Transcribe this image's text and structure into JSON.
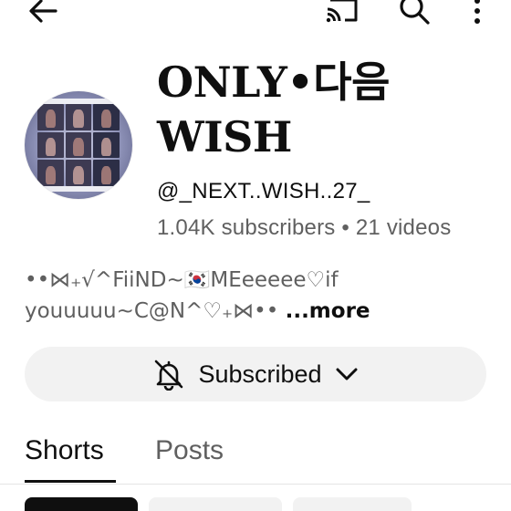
{
  "channel": {
    "title_line1": "ONLY•다음",
    "title_line2": "WISH",
    "handle": "@_NEXT..WISH..27_",
    "subscribers": "1.04K subscribers",
    "separator": "•",
    "videos": "21 videos",
    "description_line1": "••⋈₊√^FiiND~🇰🇷MEeeeee♡if",
    "description_line2": "youuuuu~C@N^♡₊⋈•• ",
    "more_label": "...more"
  },
  "subscribe": {
    "label": "Subscribed"
  },
  "tabs": [
    {
      "label": "Shorts",
      "active": true
    },
    {
      "label": "Posts",
      "active": false
    }
  ],
  "icons": {
    "back": "back-arrow-icon",
    "cast": "cast-icon",
    "search": "search-icon",
    "more": "more-vertical-icon",
    "bell": "notifications-off-icon",
    "chevron": "chevron-down-icon"
  },
  "colors": {
    "background": "#ffffff",
    "text_primary": "#0f0f0f",
    "text_secondary": "#606060",
    "button_bg": "#f2f2f2",
    "chip_active": "#0f0f0f",
    "chip_inactive": "#f2f2f2"
  }
}
